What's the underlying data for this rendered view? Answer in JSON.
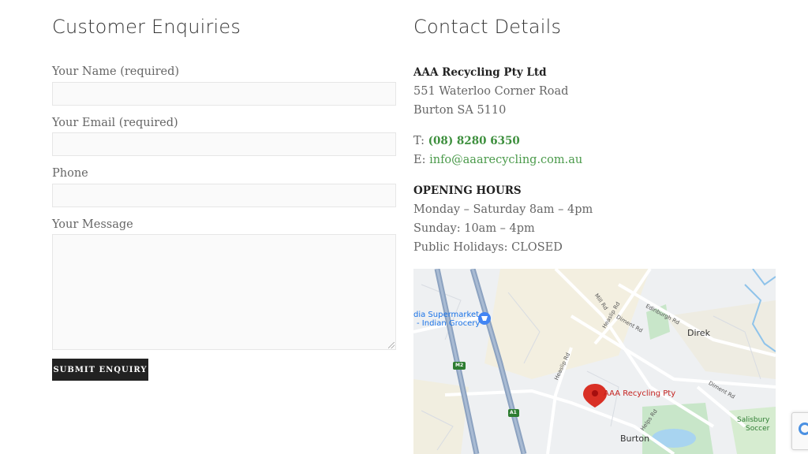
{
  "form": {
    "title": "Customer Enquiries",
    "name_label": "Your Name (required)",
    "email_label": "Your Email (required)",
    "phone_label": "Phone",
    "message_label": "Your Message",
    "submit_label": "SUBMIT ENQUIRY"
  },
  "contact": {
    "title": "Contact Details",
    "company": "AAA Recycling Pty Ltd",
    "address_line1": "551 Waterloo Corner Road",
    "address_line2": "Burton SA 5110",
    "phone_prefix": "T: ",
    "phone": "(08) 8280 6350",
    "email_prefix": "E: ",
    "email": "info@aaarecycling.com.au",
    "hours_title": "OPENING HOURS",
    "hours": [
      "Monday – Saturday 8am – 4pm",
      "Sunday: 10am – 4pm",
      "Public Holidays: CLOSED"
    ]
  },
  "map": {
    "labels": {
      "supermarket_1": "dia Supermarket",
      "supermarket_2": "- Indian Grocery",
      "mill_rd": "Mill Rd",
      "heaslip_rd_upper": "Heaslip Rd",
      "diment_rd_upper": "Diment Rd",
      "edinburgh_rd": "Edinburgh Rd",
      "direk": "Direk",
      "m2": "M2",
      "heaslip_rd_lower": "Heaslip Rd",
      "diment_rd_lower": "Diment Rd",
      "pin_label": "AAA Recycling Pty",
      "a1": "A1",
      "helps_rd": "Helps Rd",
      "salisbury_1": "Salisbury",
      "salisbury_2": "Soccer",
      "burton": "Burton"
    },
    "colors": {
      "pin": "#d93025",
      "pin_text": "#c5221f",
      "highway": "#8ca2c0",
      "park": "#c8e6c9"
    }
  }
}
